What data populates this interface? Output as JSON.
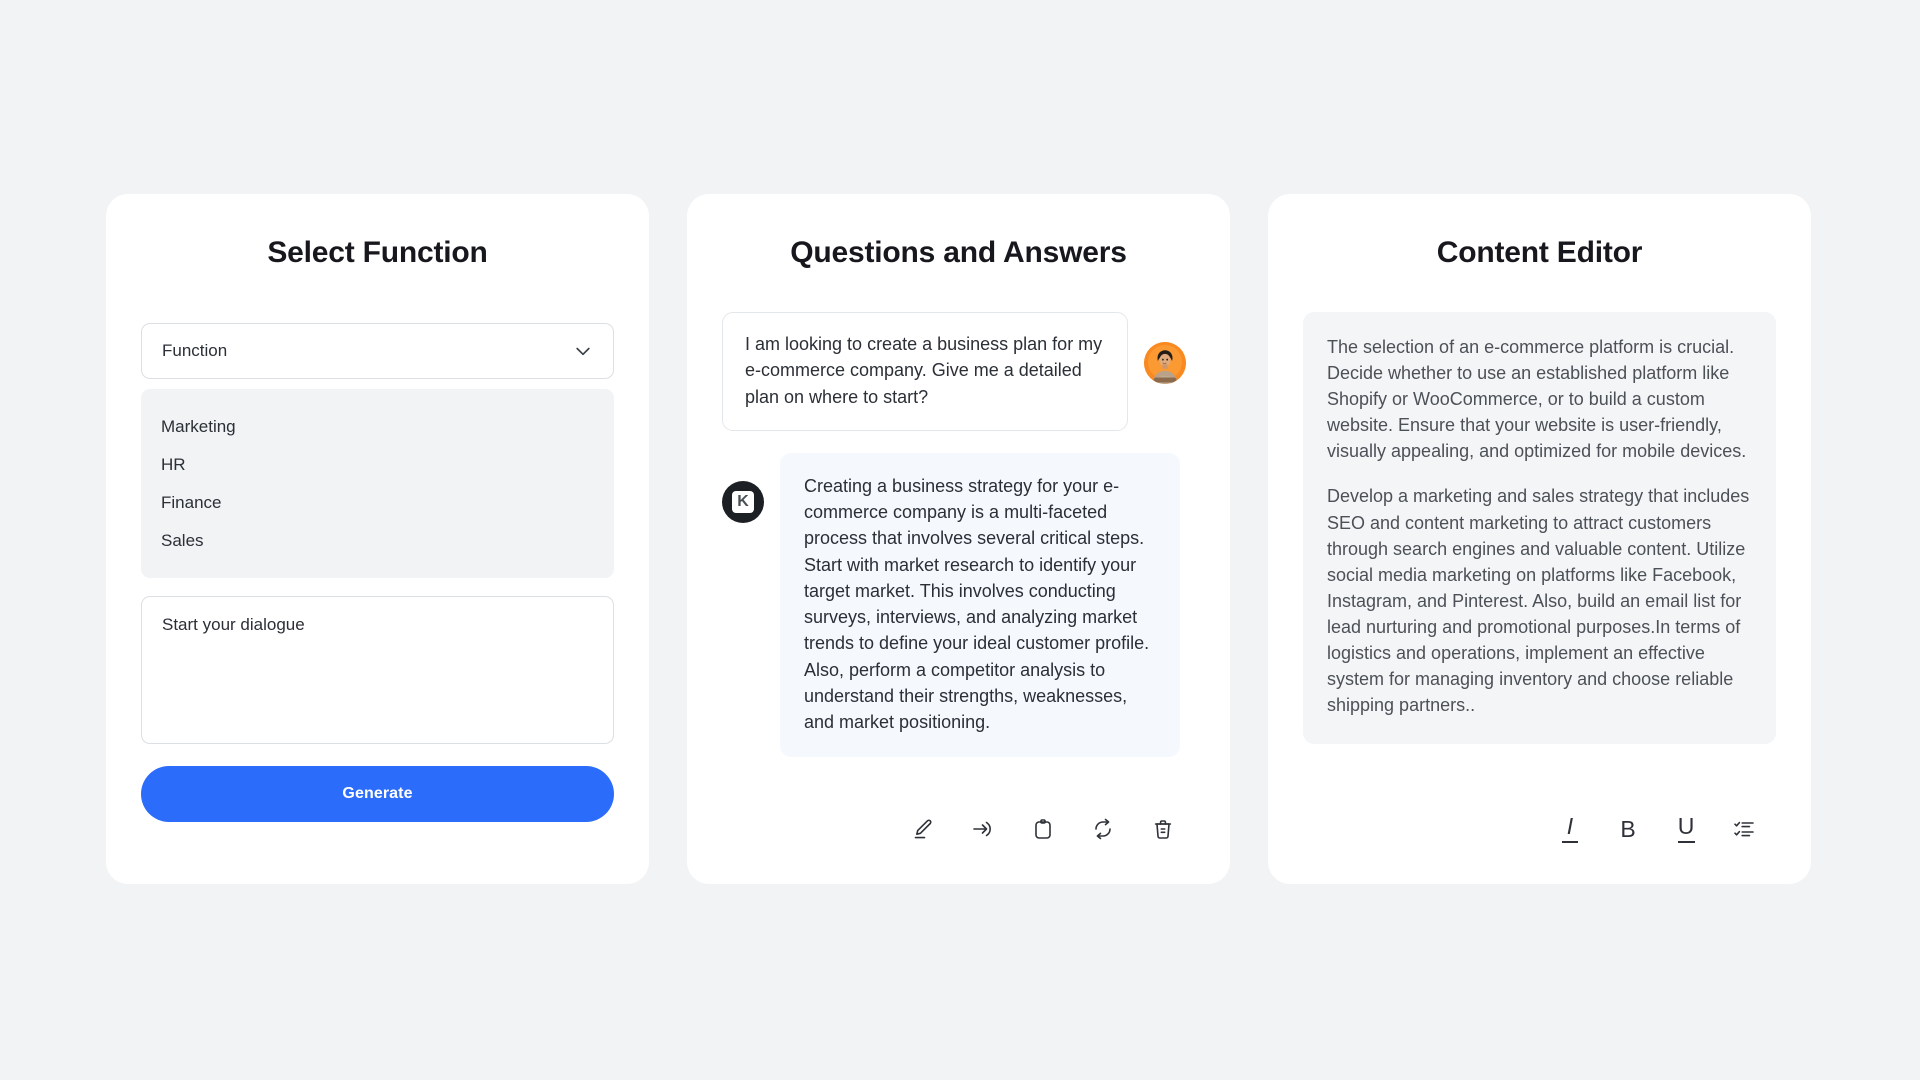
{
  "theme": {
    "page_background": "#f1f3f5",
    "card_background": "#ffffff",
    "accent_blue": "#2b6cfb",
    "ai_bubble_background": "#f5f8fd",
    "editor_background": "#f4f5f7",
    "text_primary": "#16181d",
    "text_body": "#2b2f36",
    "text_muted": "#4c5157",
    "border": "#dcdfe3",
    "avatar_background": "#f9831d",
    "brand_badge_background": "#1c1f24"
  },
  "select_panel": {
    "title": "Select Function",
    "dropdown": {
      "label": "Function",
      "icon": "chevron-down-icon",
      "options": [
        "Marketing",
        "HR",
        "Finance",
        "Sales"
      ]
    },
    "dialogue": {
      "placeholder": "Start your dialogue",
      "value": ""
    },
    "generate_button": "Generate"
  },
  "qa_panel": {
    "title": "Questions and Answers",
    "messages": [
      {
        "role": "user",
        "text": "I am looking to create a business plan for my e-commerce company. Give me a detailed plan on where to start?",
        "avatar": "user-avatar"
      },
      {
        "role": "assistant",
        "text": "Creating a business strategy for your e-commerce company is a multi-faceted process that involves several critical steps. Start with market research to identify your target market. This involves conducting surveys, interviews, and analyzing market trends to define your ideal customer profile. Also, perform a competitor analysis to understand their strengths, weaknesses, and market positioning.",
        "avatar": "brand-badge",
        "badge_letter": "K"
      }
    ],
    "toolbar": [
      {
        "name": "edit-icon",
        "label": "Edit"
      },
      {
        "name": "send-icon",
        "label": "Send"
      },
      {
        "name": "copy-icon",
        "label": "Copy"
      },
      {
        "name": "refresh-icon",
        "label": "Regenerate"
      },
      {
        "name": "trash-icon",
        "label": "Delete"
      }
    ]
  },
  "editor_panel": {
    "title": "Content Editor",
    "paragraphs": [
      "The selection of an e-commerce platform is crucial. Decide whether to use an established platform like Shopify or WooCommerce, or to build a custom website. Ensure that your website is user-friendly, visually appealing, and optimized for mobile devices.",
      "Develop a marketing and sales strategy that includes SEO and content marketing to attract customers through search engines and valuable content. Utilize social media marketing on platforms like Facebook, Instagram, and Pinterest. Also, build an email list for lead nurturing and promotional purposes.In terms of logistics and operations, implement an effective system for managing inventory and choose reliable shipping partners.."
    ],
    "toolbar": [
      {
        "name": "italic-icon",
        "label": "I"
      },
      {
        "name": "bold-icon",
        "label": "B"
      },
      {
        "name": "underline-icon",
        "label": "U"
      },
      {
        "name": "checklist-icon",
        "label": "Checklist"
      }
    ]
  }
}
